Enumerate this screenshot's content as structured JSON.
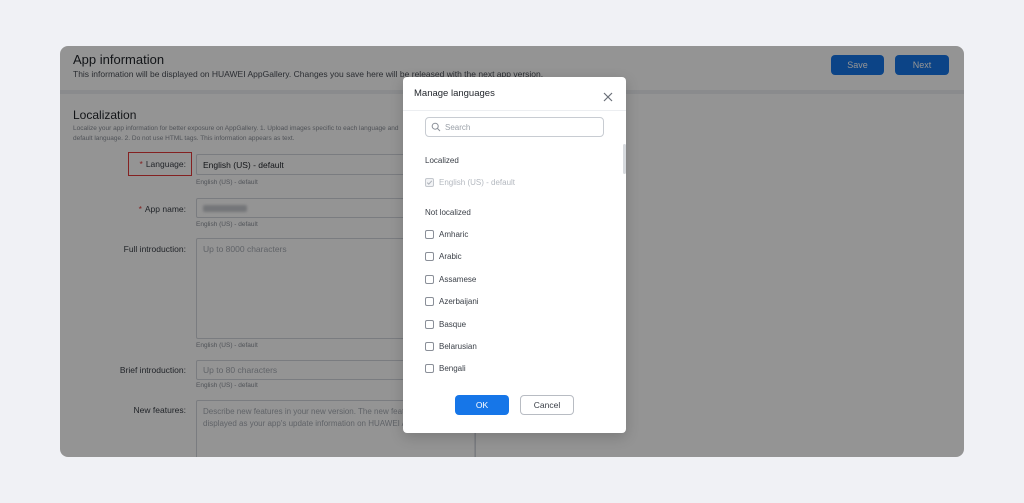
{
  "header": {
    "title": "App information",
    "subtitle": "This information will be displayed on HUAWEI AppGallery. Changes you save here will be released with the next app version.",
    "save_label": "Save",
    "next_label": "Next"
  },
  "localization": {
    "title": "Localization",
    "description": "Localize your app information for better exposure on AppGallery. 1. Upload images specific to each language and default language. 2. Do not use HTML tags. This information appears as text."
  },
  "form": {
    "required_mark": "*",
    "language": {
      "label": "Language:",
      "value": "English (US) - default",
      "hint": "English (US) - default"
    },
    "app_name": {
      "label": "App name:",
      "hint": "English (US) - default"
    },
    "full_intro": {
      "label": "Full introduction:",
      "placeholder": "Up to 8000 characters",
      "hint": "English (US) - default"
    },
    "brief_intro": {
      "label": "Brief introduction:",
      "placeholder": "Up to 80 characters",
      "hint": "English (US) - default"
    },
    "new_features": {
      "label": "New features:",
      "placeholder": "Describe new features in your new version. The new features will be displayed as your app's update information on HUAWEI AppGallery."
    }
  },
  "dialog": {
    "title": "Manage languages",
    "search_placeholder": "Search",
    "localized_label": "Localized",
    "localized_items": [
      {
        "label": "English (US) - default",
        "checked": true,
        "disabled": true
      }
    ],
    "not_localized_label": "Not localized",
    "not_localized_items": [
      "Amharic",
      "Arabic",
      "Assamese",
      "Azerbaijani",
      "Basque",
      "Belarusian",
      "Bengali"
    ],
    "ok_label": "OK",
    "cancel_label": "Cancel"
  },
  "colors": {
    "primary": "#1676e8",
    "required": "#e33a3a",
    "overlay": "rgba(0,0,0,0.42)"
  }
}
